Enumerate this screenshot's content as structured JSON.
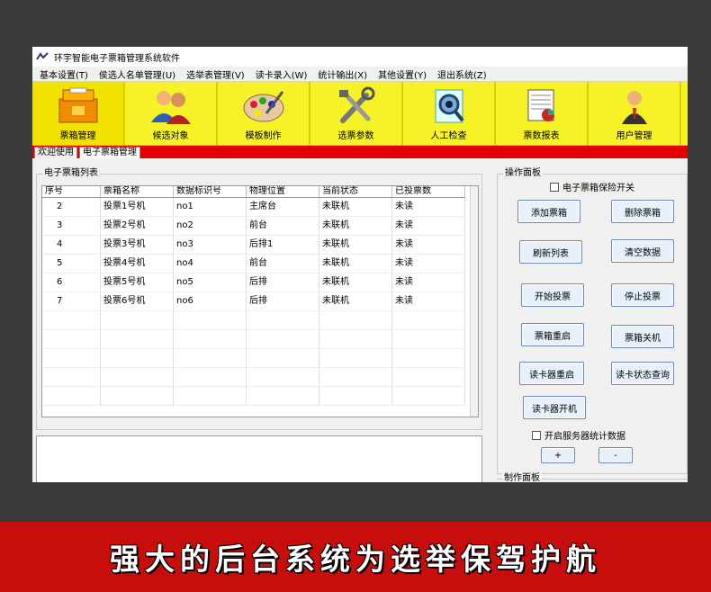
{
  "window": {
    "title": "环宇智能电子票箱管理系统软件"
  },
  "menubar": [
    "基本设置(T)",
    "侯选人名单管理(U)",
    "选举表管理(V)",
    "读卡录入(W)",
    "统计输出(X)",
    "其他设置(Y)",
    "退出系统(Z)"
  ],
  "toolbar": [
    {
      "label": "票箱管理",
      "icon": "ballot-box-icon"
    },
    {
      "label": "候选对象",
      "icon": "users-icon"
    },
    {
      "label": "模板制作",
      "icon": "palette-icon"
    },
    {
      "label": "选票参数",
      "icon": "tools-icon"
    },
    {
      "label": "人工检查",
      "icon": "magnifier-icon"
    },
    {
      "label": "票数报表",
      "icon": "report-icon"
    },
    {
      "label": "用户管理",
      "icon": "user-icon"
    }
  ],
  "tabs": [
    "欢迎使用",
    "电子票箱管理"
  ],
  "list_group": {
    "title": "电子票箱列表",
    "columns": [
      "序号",
      "票箱名称",
      "数据标识号",
      "物理位置",
      "当前状态",
      "已投票数"
    ],
    "rows": [
      [
        "2",
        "投票1号机",
        "no1",
        "主席台",
        "未联机",
        "未读"
      ],
      [
        "3",
        "投票2号机",
        "no2",
        "前台",
        "未联机",
        "未读"
      ],
      [
        "4",
        "投票3号机",
        "no3",
        "后排1",
        "未联机",
        "未读"
      ],
      [
        "5",
        "投票4号机",
        "no4",
        "前台",
        "未联机",
        "未读"
      ],
      [
        "6",
        "投票5号机",
        "no5",
        "后排",
        "未联机",
        "未读"
      ],
      [
        "7",
        "投票6号机",
        "no6",
        "后排",
        "未联机",
        "未读"
      ]
    ]
  },
  "ops_panel": {
    "title": "操作面板",
    "insurance_checkbox": "电子票箱保险开关",
    "buttons": {
      "add": "添加票箱",
      "delete": "删除票箱",
      "refresh": "刷新列表",
      "clear": "清空数据",
      "start": "开始投票",
      "stop": "停止投票",
      "restart": "票箱重启",
      "shutdown": "票箱关机",
      "reader_restart": "读卡器重启",
      "reader_status": "读卡状态查询",
      "reader_on": "读卡器开机"
    },
    "server_checkbox": "开启服务器统计数据",
    "plus": "+",
    "minus": "-"
  },
  "make_panel": {
    "title": "制作面板"
  },
  "banner": {
    "text": "强大的后台系统为选举保驾护航"
  },
  "colors": {
    "toolbar_bg": "#f5f227",
    "tab_bar": "#e50000",
    "banner_bg": "#c80d0d",
    "page_bg": "#3a3a3d"
  }
}
